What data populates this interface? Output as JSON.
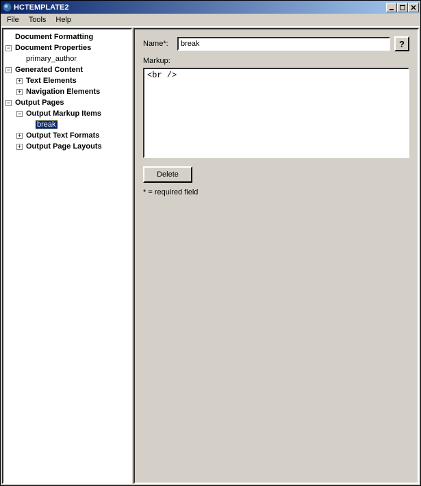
{
  "window": {
    "title": "HCTEMPLATE2"
  },
  "menu": {
    "file": "File",
    "tools": "Tools",
    "help": "Help"
  },
  "tree": {
    "doc_formatting": "Document Formatting",
    "doc_properties": "Document Properties",
    "primary_author": "primary_author",
    "generated_content": "Generated Content",
    "text_elements": "Text Elements",
    "nav_elements": "Navigation Elements",
    "output_pages": "Output Pages",
    "output_markup_items": "Output Markup Items",
    "break": "break",
    "output_text_formats": "Output Text Formats",
    "output_page_layouts": "Output Page Layouts"
  },
  "form": {
    "name_label": "Name*:",
    "name_value": "break",
    "markup_label": "Markup:",
    "markup_value": "<br />",
    "delete_label": "Delete",
    "required_note": "* = required field",
    "help_label": "?"
  },
  "titlebar_buttons": {
    "min": "_",
    "max": "□",
    "close": "✕"
  }
}
